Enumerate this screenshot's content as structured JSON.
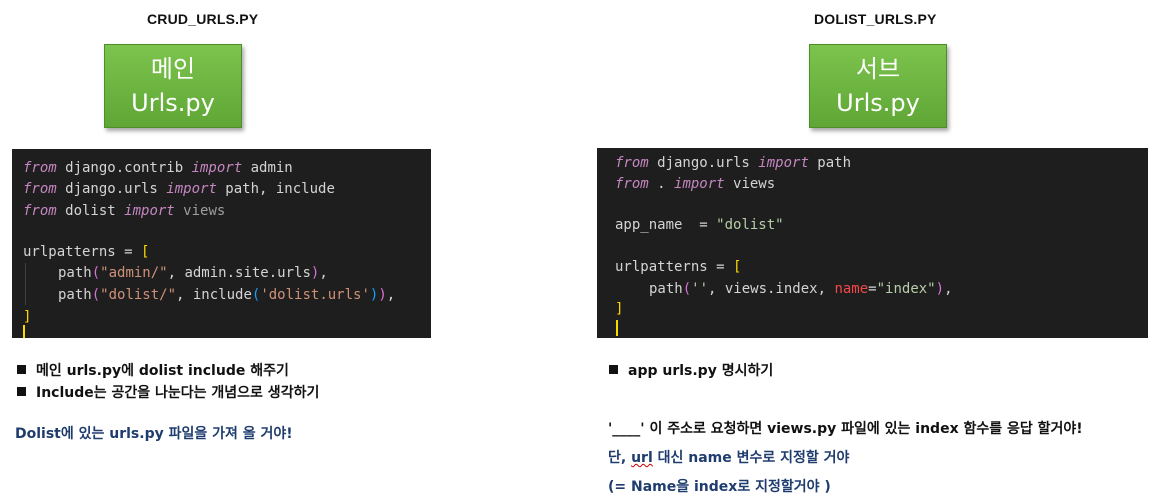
{
  "left": {
    "title": "CRUD_URLS.PY",
    "box_line1": "메인",
    "box_line2": "Urls.py",
    "code": {
      "l1_a": "from",
      "l1_b": " django.contrib ",
      "l1_c": "import",
      "l1_d": " admin",
      "l2_a": "from",
      "l2_b": " django.urls ",
      "l2_c": "import",
      "l2_d": " path, include",
      "l3_a": "from",
      "l3_b": " dolist ",
      "l3_c": "import",
      "l3_d": " views",
      "l5_a": "urlpatterns ",
      "l5_b": "= ",
      "l5_c": "[",
      "l6_a": "path",
      "l6_b": "(",
      "l6_c": "\"admin/\"",
      "l6_d": ", admin.site.urls",
      "l6_e": ")",
      "l6_f": ",",
      "l7_a": "path",
      "l7_b": "(",
      "l7_c": "\"dolist/\"",
      "l7_d": ", include",
      "l7_e": "(",
      "l7_f": "'dolist.urls'",
      "l7_g": ")",
      "l7_h": ")",
      "l7_i": ",",
      "l8_a": "]"
    },
    "bullets": [
      "메인 urls.py에 dolist include 해주기",
      "Include는 공간을 나눈다는 개념으로 생각하기"
    ],
    "note": "Dolist에 있는 urls.py 파일을 가져 올 거야!"
  },
  "right": {
    "title": "DOLIST_URLS.PY",
    "box_line1": "서브",
    "box_line2": "Urls.py",
    "code": {
      "l1_a": "from",
      "l1_b": " django.urls ",
      "l1_c": "import",
      "l1_d": " path",
      "l2_a": "from",
      "l2_b": " . ",
      "l2_c": "import",
      "l2_d": " views",
      "l4_a": "app_name  ",
      "l4_b": "= ",
      "l4_c": "\"dolist\"",
      "l6_a": "urlpatterns ",
      "l6_b": "= ",
      "l6_c": "[",
      "l7_a": "path",
      "l7_b": "(",
      "l7_c": "''",
      "l7_d": ", views.index, ",
      "l7_e": "name",
      "l7_f": "=",
      "l7_g": "\"index\"",
      "l7_h": ")",
      "l7_i": ",",
      "l8_a": "]"
    },
    "bullet": "app urls.py 명시하기",
    "note1": "'____' 이 주소로 요청하면 views.py 파일에 있는 index 함수를 응답 할거야!",
    "note2_a": "단, ",
    "note2_b": "url",
    "note2_c": " 대신 name 변수로 지정할 거야",
    "note3": "(= Name을 index로 지정할거야 )"
  }
}
